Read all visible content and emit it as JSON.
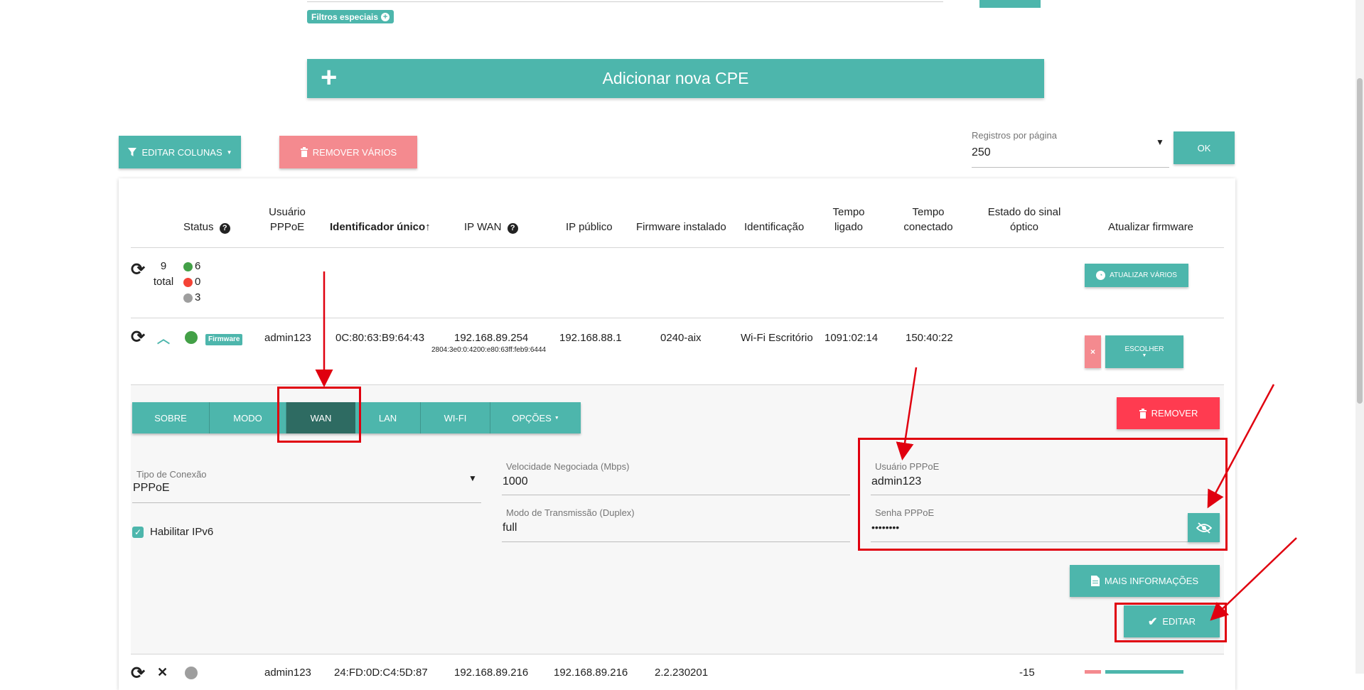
{
  "filters": {
    "special_label": "Filtros especiais"
  },
  "add_cpe": {
    "label": "Adicionar nova CPE"
  },
  "toolbar": {
    "edit_columns": "EDITAR COLUNAS",
    "remove_many": "REMOVER VÁRIOS",
    "records_per_page_label": "Registros por página",
    "records_per_page_value": "250",
    "ok": "OK"
  },
  "table": {
    "headers": {
      "status": "Status",
      "usuario_l1": "Usuário",
      "usuario_l2": "PPPoE",
      "identificador": "Identificador único↑",
      "ip_wan": "IP WAN",
      "ip_publico": "IP público",
      "firmware": "Firmware instalado",
      "identificacao": "Identificação",
      "tempo_ligado_l1": "Tempo",
      "tempo_ligado_l2": "ligado",
      "tempo_conectado_l1": "Tempo",
      "tempo_conectado_l2": "conectado",
      "estado_l1": "Estado do sinal",
      "estado_l2": "óptico",
      "atualizar": "Atualizar firmware"
    },
    "summary": {
      "total_num": "9",
      "total_label": "total",
      "green": "6",
      "red": "0",
      "gray": "3",
      "update_many": "ATUALIZAR VÁRIOS"
    },
    "row1": {
      "badge": "Firmware",
      "usuario": "admin123",
      "identificador": "0C:80:63:B9:64:43",
      "ip_wan": "192.168.89.254",
      "ip_wan_v6": "2804:3e0:0:4200:e80:63ff:feb9:6444",
      "ip_publico": "192.168.88.1",
      "firmware": "0240-aix",
      "identificacao": "Wi-Fi Escritório",
      "tempo_ligado": "1091:02:14",
      "tempo_conectado": "150:40:22",
      "escolher": "ESCOLHER",
      "x": "×"
    },
    "row2": {
      "usuario": "admin123",
      "identificador": "24:FD:0D:C4:5D:87",
      "ip_wan": "192.168.89.216",
      "ip_publico": "192.168.89.216",
      "firmware": "2.2.230201",
      "sinal": "-15"
    }
  },
  "tabs": [
    "SOBRE",
    "MODO",
    "WAN",
    "LAN",
    "WI-FI",
    "OPÇÕES"
  ],
  "wan": {
    "remover": "REMOVER",
    "tipo_label": "Tipo de Conexão",
    "tipo_value": "PPPoE",
    "habilitar_ipv6": "Habilitar IPv6",
    "velocidade_label": "Velocidade Negociada (Mbps)",
    "velocidade_value": "1000",
    "modo_label": "Modo de Transmissão (Duplex)",
    "modo_value": "full",
    "usuario_label": "Usuário PPPoE",
    "usuario_value": "admin123",
    "senha_label": "Senha PPPoE",
    "senha_value": "••••••••",
    "mais_info": "MAIS INFORMAÇÕES",
    "editar": "EDITAR"
  },
  "colors": {
    "teal": "#4db6ac",
    "teal_dark": "#2e6b62",
    "red": "#ff3b50",
    "pink": "#f48a8f",
    "annotation": "#e0000f"
  }
}
